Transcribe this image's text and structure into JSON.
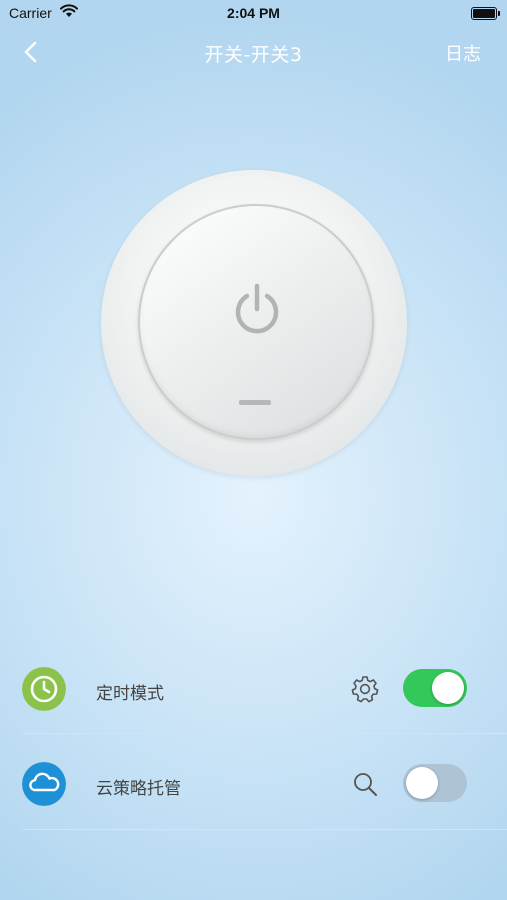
{
  "status_bar": {
    "carrier": "Carrier",
    "time": "2:04 PM"
  },
  "nav": {
    "title": "开关-开关3",
    "right_label": "日志"
  },
  "power_switch": {
    "state": "off"
  },
  "rows": [
    {
      "label": "定时模式",
      "icon": "clock-icon",
      "icon_color": "#8bc34a",
      "action_icon": "gear-icon",
      "toggle_on": true
    },
    {
      "label": "云策略托管",
      "icon": "cloud-icon",
      "icon_color": "#1e90d6",
      "action_icon": "search-icon",
      "toggle_on": false
    }
  ],
  "colors": {
    "toggle_on": "#34c759",
    "toggle_off": "#aec4d5",
    "nav_text": "#ffffff"
  }
}
